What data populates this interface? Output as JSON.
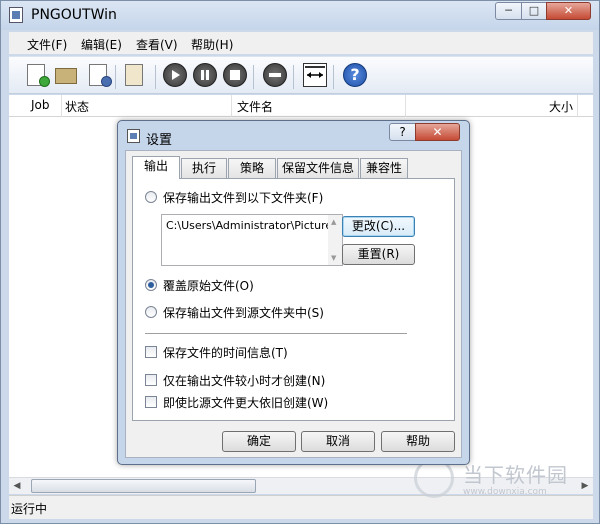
{
  "window": {
    "title": "PNGOUTWin",
    "min_label": "─",
    "max_label": "□",
    "close_label": "✕"
  },
  "menu": {
    "items": [
      {
        "label": "文件(F)"
      },
      {
        "label": "编辑(E)"
      },
      {
        "label": "查看(V)"
      },
      {
        "label": "帮助(H)"
      }
    ]
  },
  "toolbar": {
    "icons": [
      "new-file-icon",
      "add-folder-icon",
      "file-info-icon",
      "paste-icon",
      "play-icon",
      "pause-icon",
      "stop-icon",
      "remove-icon",
      "fit-width-icon",
      "help-icon"
    ]
  },
  "list": {
    "columns": [
      "Job",
      "状态",
      "文件名",
      "大小"
    ]
  },
  "status": {
    "text": "运行中"
  },
  "watermark": {
    "text": "当下软件园",
    "url": "www.downxia.com"
  },
  "dialog": {
    "title": "设置",
    "help_label": "?",
    "close_label": "✕",
    "tabs": [
      {
        "label": "输出"
      },
      {
        "label": "执行"
      },
      {
        "label": "策略"
      },
      {
        "label": "保留文件信息"
      },
      {
        "label": "兼容性"
      }
    ],
    "output": {
      "opt_folder": "保存输出文件到以下文件夹(F)",
      "path": "C:\\Users\\Administrator\\Pictures",
      "change_button": "更改(C)...",
      "reset_button": "重置(R)",
      "opt_overwrite": "覆盖原始文件(O)",
      "opt_source": "保存输出文件到源文件夹中(S)",
      "chk_time": "保存文件的时间信息(T)",
      "chk_smaller": "仅在输出文件较小时才创建(N)",
      "chk_larger": "即使比源文件更大依旧创建(W)",
      "selected_option": "覆盖原始文件(O)"
    },
    "buttons": {
      "ok": "确定",
      "cancel": "取消",
      "help": "帮助"
    }
  }
}
